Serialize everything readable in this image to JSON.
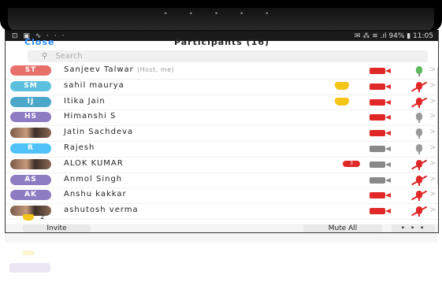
{
  "status_bar": {
    "left_icons": "⊡ ▣ ∿ · · ·",
    "right_text": "✉ ⁂ ≋ .ıl 94% ▮ 11:05"
  },
  "pager_dots": "• • • • •",
  "header": {
    "close_label": "Close",
    "title": "Participants (16)"
  },
  "search": {
    "placeholder": "Search"
  },
  "participants": [
    {
      "initials": "ST",
      "color": "#e8706b",
      "name": "Sanjeev Talwar",
      "role": "(Host, me)",
      "hand": false,
      "video": "off",
      "mic": "on"
    },
    {
      "initials": "SM",
      "color": "#5bc0de",
      "name": "sahil maurya",
      "role": "",
      "hand": true,
      "video": "off",
      "mic": "muted"
    },
    {
      "initials": "IJ",
      "color": "#4ba8c9",
      "name": "Itika Jain",
      "role": "",
      "hand": true,
      "video": "off",
      "mic": "muted"
    },
    {
      "initials": "HS",
      "color": "#8e7cc3",
      "name": "Himanshi S",
      "role": "",
      "hand": false,
      "video": "off",
      "mic": "idle"
    },
    {
      "initials": "",
      "color": "photo",
      "name": "Jatin Sachdeva",
      "role": "",
      "hand": false,
      "video": "off",
      "mic": "idle"
    },
    {
      "initials": "R",
      "color": "#4fc3f7",
      "name": "Rajesh",
      "role": "",
      "hand": false,
      "video": "on",
      "mic": "idle"
    },
    {
      "initials": "",
      "color": "photo",
      "name": "ALOK KUMAR",
      "role": "",
      "hand": false,
      "badge": "3",
      "video": "on",
      "mic": "muted"
    },
    {
      "initials": "AS",
      "color": "#8e7cc3",
      "name": "Anmol Singh",
      "role": "",
      "hand": false,
      "video": "on",
      "mic": "muted"
    },
    {
      "initials": "AK",
      "color": "#8e7cc3",
      "name": "Anshu kakkar",
      "role": "",
      "hand": false,
      "video": "off",
      "mic": "muted"
    },
    {
      "initials": "",
      "color": "photo",
      "name": "ashutosh verma",
      "role": "",
      "hand": false,
      "video": "off",
      "mic": "muted"
    }
  ],
  "raised_hands_count": "2",
  "footer": {
    "invite_label": "Invite",
    "mute_all_label": "Mute All",
    "more_label": "• • •"
  },
  "colors": {
    "accent": "#2d8cff",
    "muted_red": "#e02828",
    "hand_yellow": "#f5c518"
  }
}
